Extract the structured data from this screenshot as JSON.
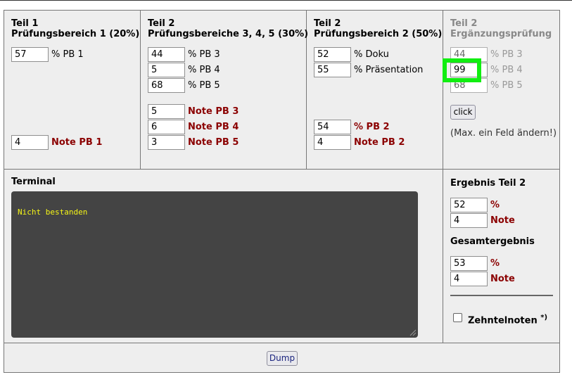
{
  "teil1": {
    "heading_line1": "Teil 1",
    "heading_line2": "Prüfungsbereich 1 (20%)",
    "pb1_percent": "57",
    "pb1_percent_label": "% PB 1",
    "pb1_note": "4",
    "pb1_note_label": "Note PB 1"
  },
  "teil2a": {
    "heading_line1": "Teil 2",
    "heading_line2": "Prüfungsbereiche 3, 4, 5 (30%)",
    "percent_rows": [
      {
        "value": "44",
        "label": "% PB 3"
      },
      {
        "value": "5",
        "label": "% PB 4"
      },
      {
        "value": "68",
        "label": "% PB 5"
      }
    ],
    "note_rows": [
      {
        "value": "5",
        "label": "Note PB 3"
      },
      {
        "value": "6",
        "label": "Note PB 4"
      },
      {
        "value": "3",
        "label": "Note PB 5"
      }
    ]
  },
  "teil2b": {
    "heading_line1": "Teil 2",
    "heading_line2": "Prüfungsbereich 2 (50%)",
    "doku_value": "52",
    "doku_label": "% Doku",
    "praes_value": "55",
    "praes_label": "% Präsentation",
    "pb2_percent": "54",
    "pb2_percent_label": "% PB 2",
    "pb2_note": "4",
    "pb2_note_label": "Note PB 2"
  },
  "ergaenzung": {
    "heading_line1": "Teil 2",
    "heading_line2": "Ergänzungsprüfung",
    "rows": [
      {
        "value": "44",
        "label": "% PB 3"
      },
      {
        "value": "99",
        "label": "% PB 4"
      },
      {
        "value": "68",
        "label": "% PB 5"
      }
    ],
    "click_label": "click",
    "hint": "(Max. ein Feld ändern!)"
  },
  "terminal": {
    "title": "Terminal",
    "output": "Nicht bestanden"
  },
  "ergebnis": {
    "teil2_title": "Ergebnis Teil 2",
    "teil2_percent": "52",
    "teil2_note": "4",
    "gesamt_title": "Gesamtergebnis",
    "gesamt_percent": "53",
    "gesamt_note": "4",
    "percent_label": "%",
    "note_label": "Note",
    "zehntel_label": "Zehntelnoten",
    "zehntel_mark": "*)"
  },
  "footer": {
    "dump_label": "Dump"
  },
  "colors": {
    "highlight": "#11ee11",
    "terminal_bg": "#444444",
    "terminal_text": "#f5f516",
    "red_label": "#8b0000"
  }
}
